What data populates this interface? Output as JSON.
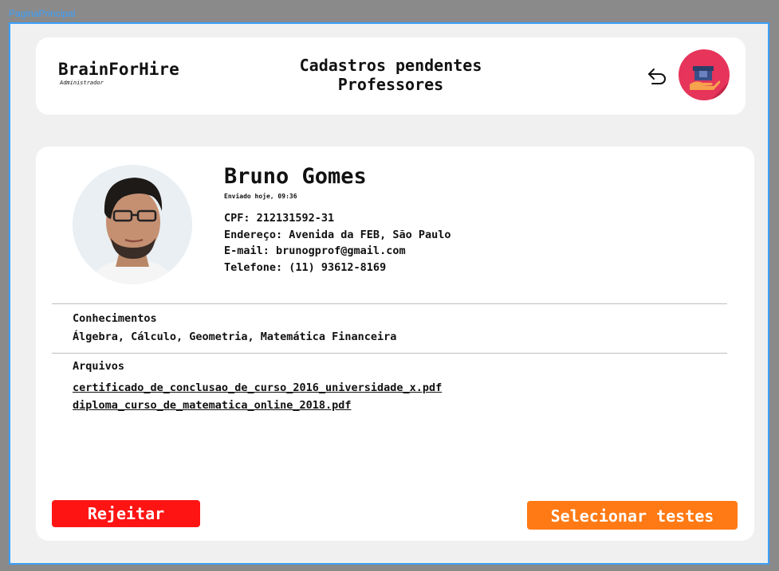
{
  "page_label": "PaginaPrincipal",
  "header": {
    "brand_name": "BrainForHire",
    "brand_role": "Administrador",
    "title_line1": "Cadastros pendentes",
    "title_line2": "Professores"
  },
  "profile": {
    "name": "Bruno Gomes",
    "sent": "Enviado hoje, 09:36",
    "cpf": "CPF: 212131592-31",
    "address": "Endereço: Avenida da FEB, São Paulo",
    "email": "E-mail: brunogprof@gmail.com",
    "phone": "Telefone: (11) 93612-8169"
  },
  "knowledge": {
    "title": "Conhecimentos",
    "text": "Álgebra, Cálculo, Geometria, Matemática Financeira"
  },
  "files": {
    "title": "Arquivos",
    "items": [
      "certificado_de_conclusao_de_curso_2016_universidade_x.pdf",
      "diploma_curso_de_matematica_online_2018.pdf"
    ]
  },
  "actions": {
    "reject_label": "Rejeitar",
    "select_tests_label": "Selecionar testes"
  },
  "colors": {
    "reject": "#ff1414",
    "select_tests": "#ff7a14",
    "logo_bg": "#e6345a",
    "frame_border": "#3aa0ff"
  }
}
